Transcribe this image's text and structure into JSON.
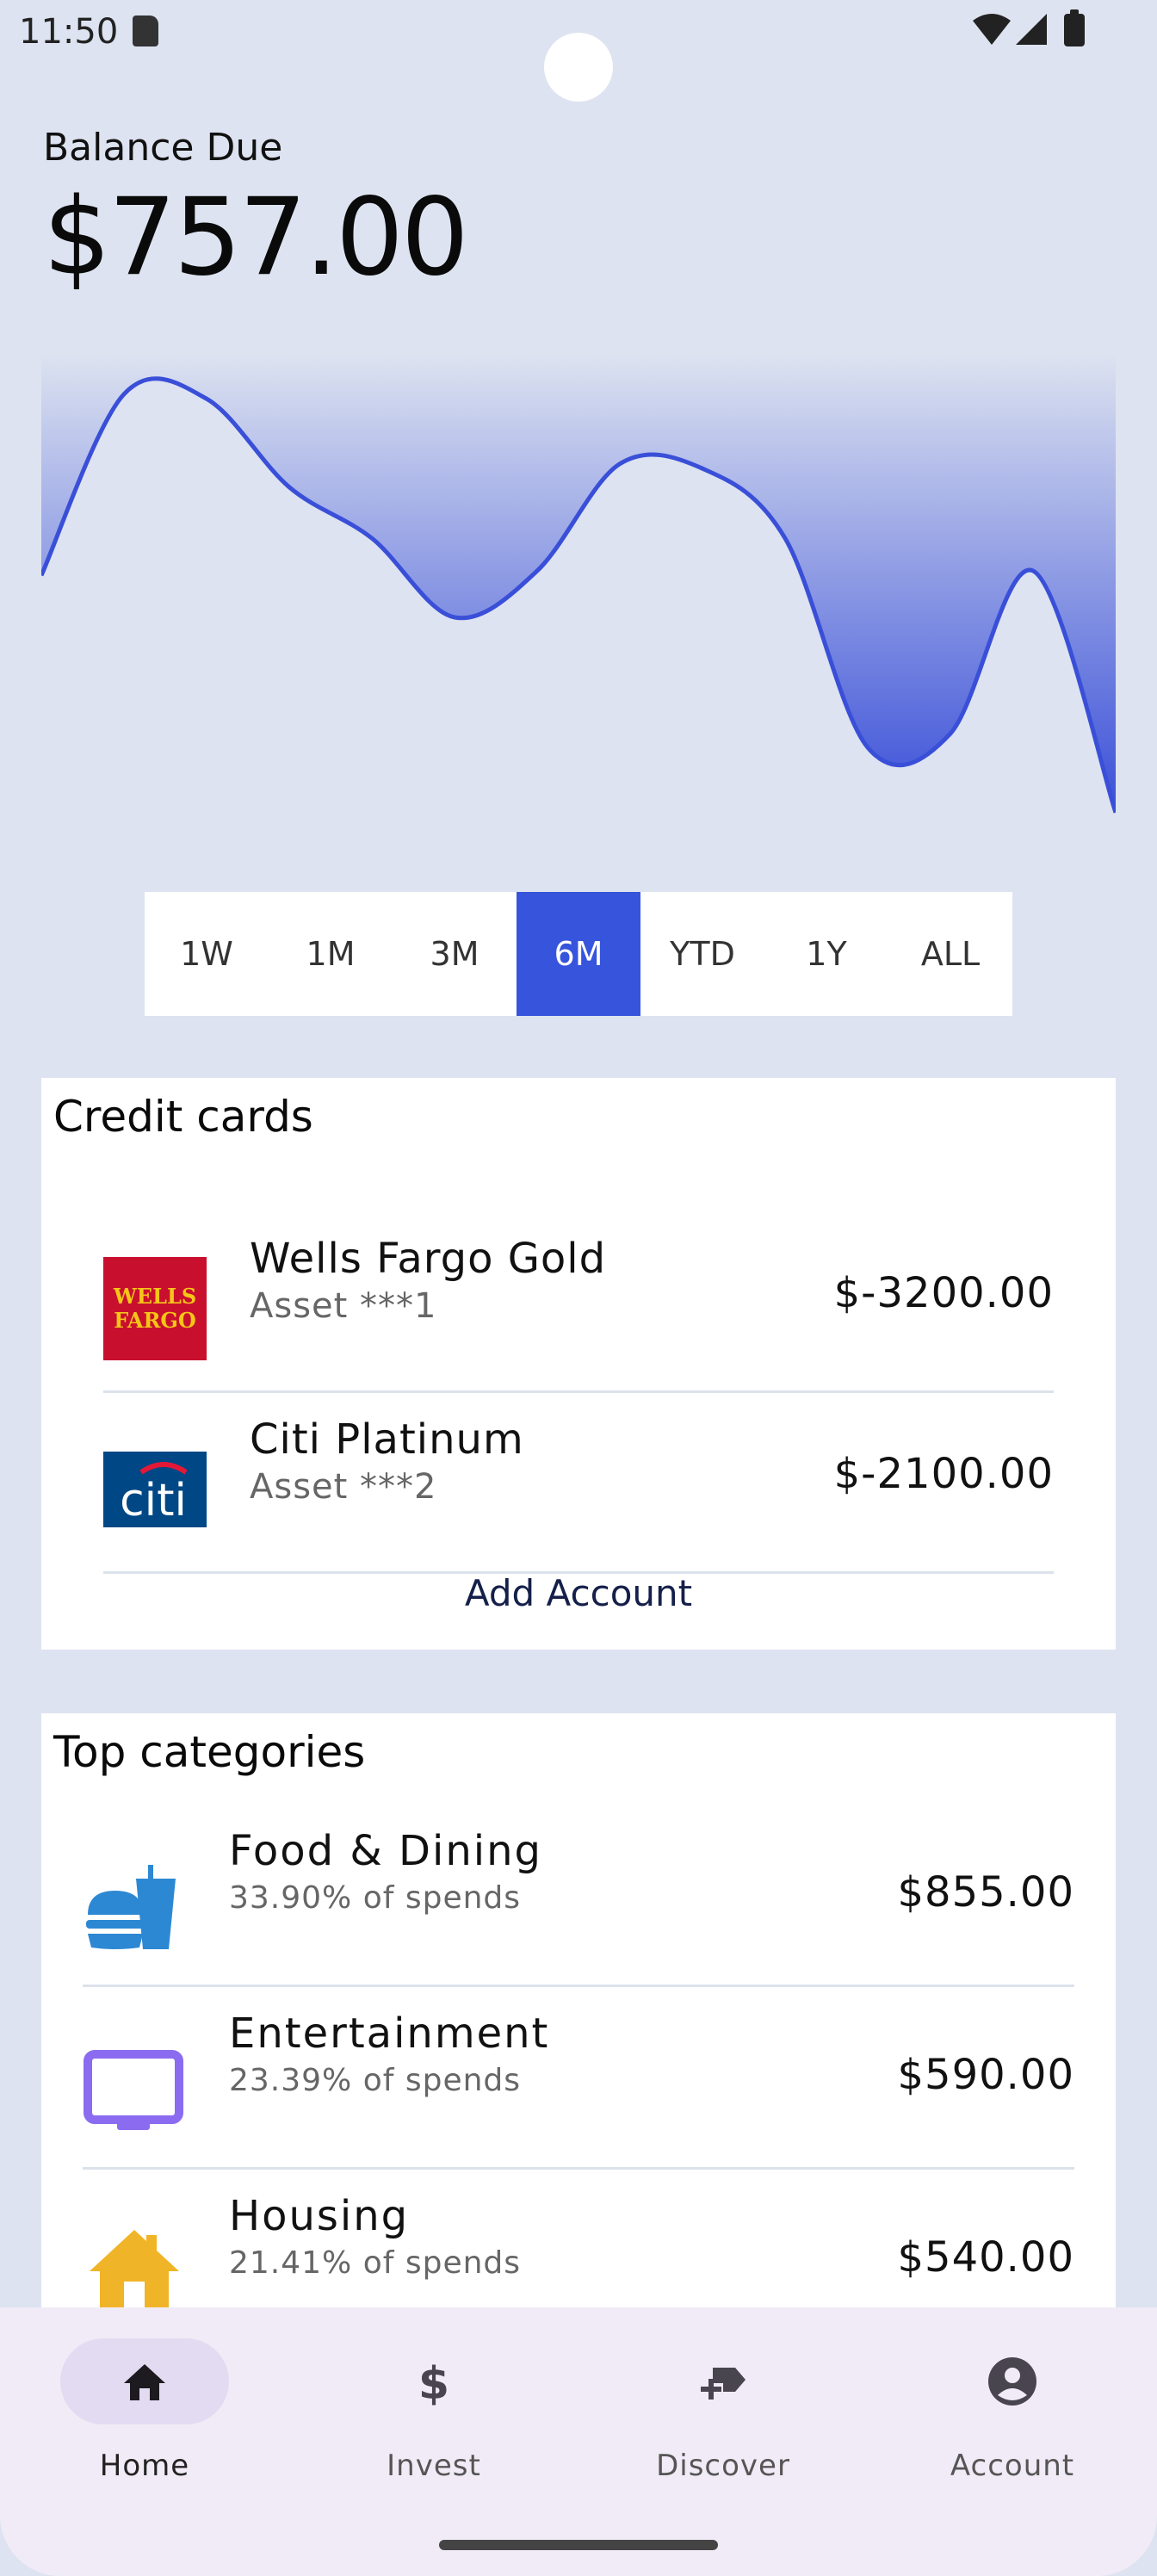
{
  "status_bar": {
    "time": "11:50"
  },
  "balance": {
    "label": "Balance Due",
    "amount": "$757.00"
  },
  "chart_data": {
    "type": "area",
    "x": [
      0,
      1,
      2,
      3,
      4,
      5,
      6,
      7,
      8,
      9,
      10,
      11,
      12,
      13
    ],
    "values": [
      0.54,
      0.93,
      0.92,
      0.73,
      0.62,
      0.45,
      0.55,
      0.78,
      0.77,
      0.62,
      0.17,
      0.2,
      0.55,
      0.03
    ],
    "ylim": [
      0,
      1
    ],
    "colors": {
      "line": "#3a4fd8",
      "fill_top": "#dde3f0",
      "fill_bottom": "#3a4fd8"
    }
  },
  "ranges": {
    "items": [
      "1W",
      "1M",
      "3M",
      "6M",
      "YTD",
      "1Y",
      "ALL"
    ],
    "selected": "6M"
  },
  "credit_cards": {
    "title": "Credit cards",
    "items": [
      {
        "name": "Wells Fargo Gold",
        "sub": "Asset ***1",
        "amount": "$-3200.00",
        "logo": "wells-fargo-logo",
        "logo_text_1": "WELLS",
        "logo_text_2": "FARGO"
      },
      {
        "name": "Citi Platinum",
        "sub": "Asset ***2",
        "amount": "$-2100.00",
        "logo": "citi-logo",
        "logo_text": "citi"
      }
    ],
    "add_label": "Add Account"
  },
  "categories": {
    "title": "Top categories",
    "items": [
      {
        "name": "Food & Dining",
        "pct": "33.90% of spends",
        "amount": "$855.00",
        "icon": "food-icon",
        "color": "#2d88d4"
      },
      {
        "name": "Entertainment",
        "pct": "23.39% of spends",
        "amount": "$590.00",
        "icon": "tv-icon",
        "color": "#8b6cf0"
      },
      {
        "name": "Housing",
        "pct": "21.41% of spends",
        "amount": "$540.00",
        "icon": "house-icon",
        "color": "#f0b428"
      }
    ]
  },
  "nav": {
    "items": [
      {
        "label": "Home",
        "icon": "home-icon",
        "active": true
      },
      {
        "label": "Invest",
        "icon": "dollar-icon",
        "active": false
      },
      {
        "label": "Discover",
        "icon": "discover-icon",
        "active": false
      },
      {
        "label": "Account",
        "icon": "account-icon",
        "active": false
      }
    ]
  }
}
